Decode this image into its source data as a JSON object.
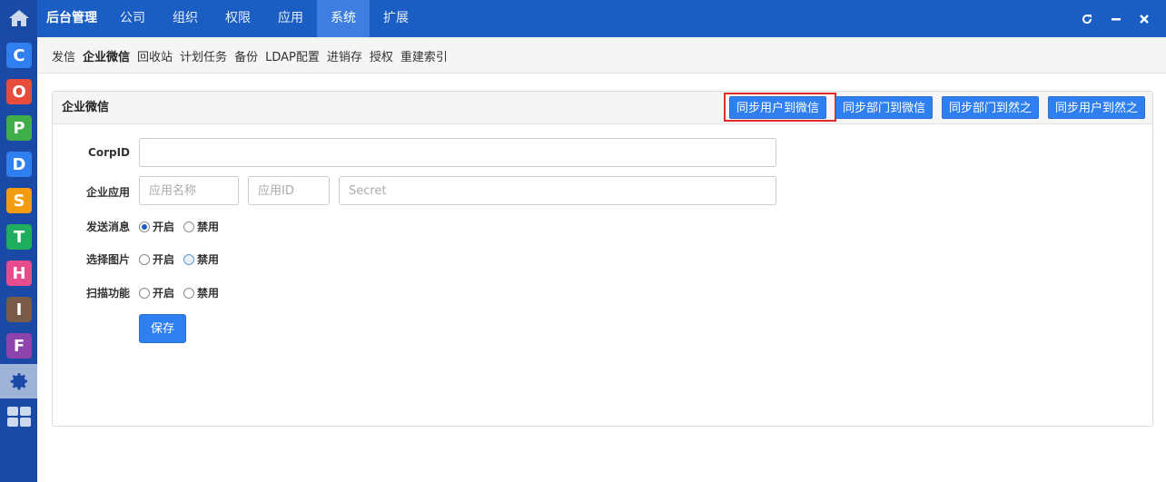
{
  "topbar": {
    "brand": "后台管理",
    "nav": [
      "公司",
      "组织",
      "权限",
      "应用",
      "系统",
      "扩展"
    ],
    "active_nav": "系统"
  },
  "sidebar": {
    "apps": [
      {
        "letter": "C",
        "color": "#2f7ff0"
      },
      {
        "letter": "O",
        "color": "#e84c3d"
      },
      {
        "letter": "P",
        "color": "#3fae49"
      },
      {
        "letter": "D",
        "color": "#2f7ff0"
      },
      {
        "letter": "S",
        "color": "#f39c12"
      },
      {
        "letter": "T",
        "color": "#1fae5f"
      },
      {
        "letter": "H",
        "color": "#e74c8c"
      },
      {
        "letter": "I",
        "color": "#7a5a48"
      },
      {
        "letter": "F",
        "color": "#8e44ad"
      }
    ]
  },
  "subnav": [
    "发信",
    "企业微信",
    "回收站",
    "计划任务",
    "备份",
    "LDAP配置",
    "进销存",
    "授权",
    "重建索引"
  ],
  "subnav_active": "企业微信",
  "panel": {
    "title": "企业微信",
    "buttons": [
      "同步用户到微信",
      "同步部门到微信",
      "同步部门到然之",
      "同步用户到然之"
    ]
  },
  "form": {
    "corpid_label": "CorpID",
    "corpid_value": "",
    "app_label": "企业应用",
    "app_name_placeholder": "应用名称",
    "app_id_placeholder": "应用ID",
    "secret_placeholder": "Secret",
    "send_label": "发送消息",
    "image_label": "选择图片",
    "scan_label": "扫描功能",
    "on_label": "开启",
    "off_label": "禁用",
    "save_label": "保存"
  }
}
